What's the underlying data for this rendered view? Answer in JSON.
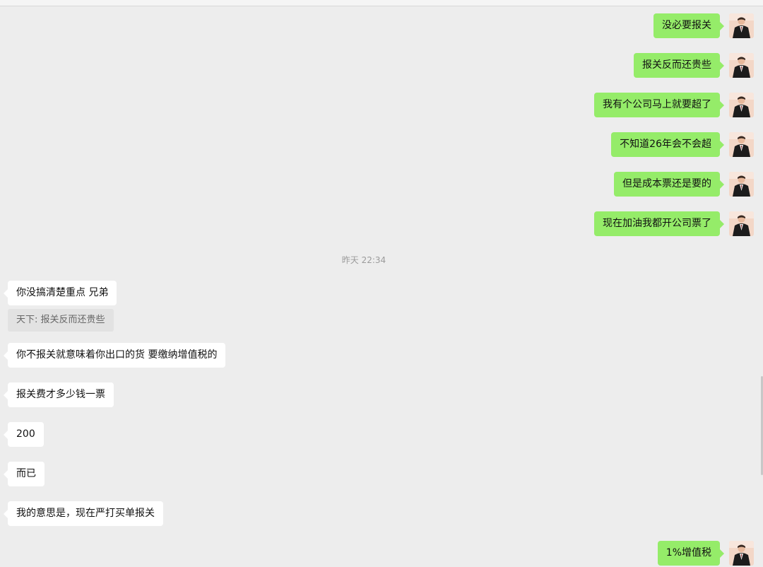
{
  "timestamp": "昨天 22:34",
  "outgoing_top": [
    "没必要报关",
    "报关反而还贵些",
    "我有个公司马上就要超了",
    "不知道26年会不会超",
    "但是成本票还是要的",
    "现在加油我都开公司票了"
  ],
  "incoming": {
    "first": "你没搞清楚重点 兄弟",
    "quote": "天下: 报关反而还贵些",
    "rest": [
      "你不报关就意味着你出口的货 要缴纳增值税的",
      "报关费才多少钱一票",
      "200",
      "而已",
      "我的意思是，现在严打买单报关"
    ]
  },
  "outgoing_bottom": "1%增值税",
  "colors": {
    "background": "#ededed",
    "outgoing_bubble": "#95ec69",
    "incoming_bubble": "#ffffff",
    "quote_background": "#e2e2e2"
  },
  "icons": {
    "avatar": "avatar-person-in-suit"
  }
}
